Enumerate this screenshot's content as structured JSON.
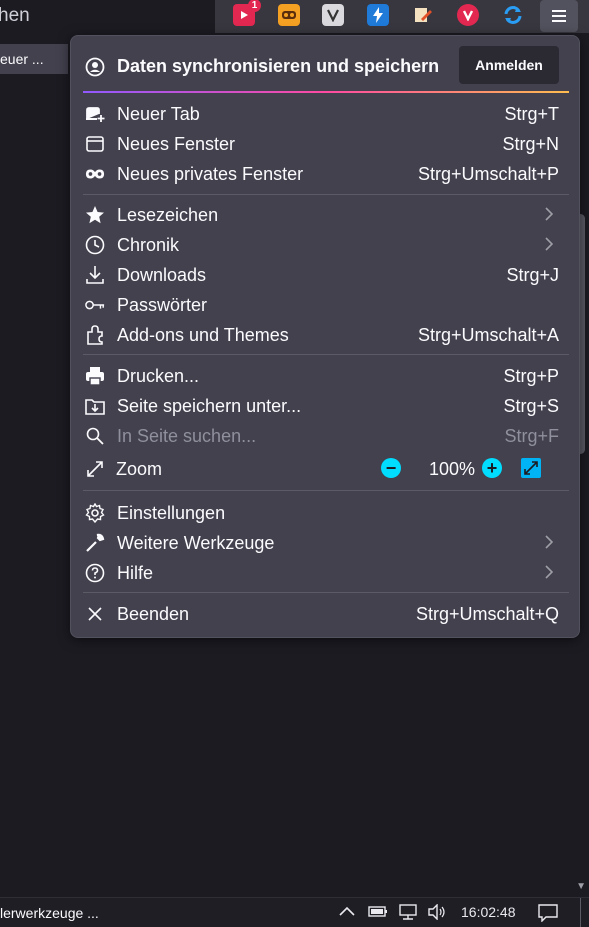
{
  "toolbar": {
    "url_fragment": "hen",
    "tab_fragment": "euer ...",
    "extension_badge": "1",
    "extensions": [
      "youtube-icon",
      "css-icon",
      "v-icon",
      "bolt-icon",
      "edit-icon",
      "vivaldi-icon",
      "sync-arrows-icon"
    ]
  },
  "menu": {
    "sync_title": "Daten synchronisieren und speichern",
    "signin_label": "Anmelden",
    "items": [
      {
        "label": "Neuer Tab",
        "shortcut": "Strg+T",
        "icon": "new-tab-icon"
      },
      {
        "label": "Neues Fenster",
        "shortcut": "Strg+N",
        "icon": "window-icon"
      },
      {
        "label": "Neues privates Fenster",
        "shortcut": "Strg+Umschalt+P",
        "icon": "mask-icon"
      },
      {
        "label": "Lesezeichen",
        "shortcut": "",
        "icon": "star-icon"
      },
      {
        "label": "Chronik",
        "shortcut": "",
        "icon": "clock-icon"
      },
      {
        "label": "Downloads",
        "shortcut": "Strg+J",
        "icon": "download-icon"
      },
      {
        "label": "Passwörter",
        "shortcut": "",
        "icon": "key-icon"
      },
      {
        "label": "Add-ons und Themes",
        "shortcut": "Strg+Umschalt+A",
        "icon": "puzzle-icon"
      },
      {
        "label": "Drucken...",
        "shortcut": "Strg+P",
        "icon": "printer-icon"
      },
      {
        "label": "Seite speichern unter...",
        "shortcut": "Strg+S",
        "icon": "save-icon"
      },
      {
        "label": "In Seite suchen...",
        "shortcut": "Strg+F",
        "icon": "search-icon"
      },
      {
        "label": "Zoom",
        "shortcut": "",
        "icon": "zoom-icon"
      },
      {
        "label": "Einstellungen",
        "shortcut": "",
        "icon": "gear-icon"
      },
      {
        "label": "Weitere Werkzeuge",
        "shortcut": "",
        "icon": "wrench-icon"
      },
      {
        "label": "Hilfe",
        "shortcut": "",
        "icon": "help-icon"
      },
      {
        "label": "Beenden",
        "shortcut": "Strg+Umschalt+Q",
        "icon": "close-icon"
      }
    ],
    "zoom_level": "100%",
    "zoom_minus": "−",
    "zoom_plus": "+"
  },
  "statusbar": {
    "text": "lerwerkzeuge ...",
    "time": "16:02:48"
  },
  "colors": {
    "panel_bg": "#42414d",
    "accent_zoom": "#00ddff",
    "page_bg": "#1c1b22"
  }
}
